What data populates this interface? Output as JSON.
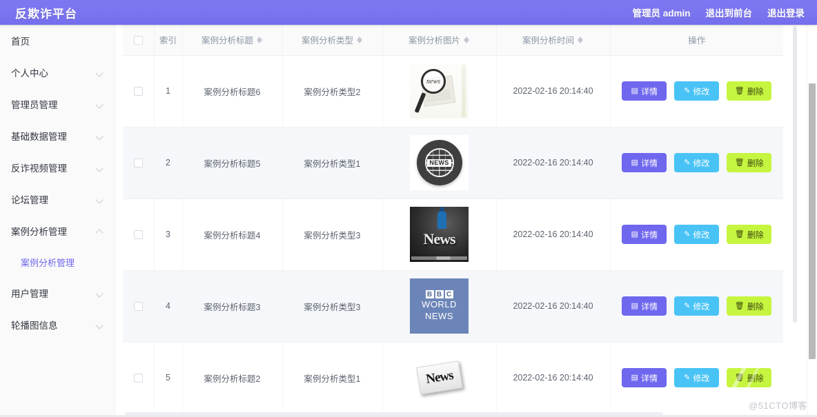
{
  "header": {
    "brand": "反欺诈平台",
    "user": "管理员 admin",
    "exit_front": "退出到前台",
    "logout": "退出登录"
  },
  "sidebar": {
    "items": [
      {
        "label": "首页",
        "expandable": false
      },
      {
        "label": "个人中心",
        "expandable": true
      },
      {
        "label": "管理员管理",
        "expandable": true
      },
      {
        "label": "基础数据管理",
        "expandable": true
      },
      {
        "label": "反诈视频管理",
        "expandable": true
      },
      {
        "label": "论坛管理",
        "expandable": true
      },
      {
        "label": "案例分析管理",
        "expandable": true,
        "expanded": true
      }
    ],
    "submenu": [
      {
        "label": "案例分析管理",
        "active": true
      }
    ],
    "items_after": [
      {
        "label": "用户管理",
        "expandable": true
      },
      {
        "label": "轮播图信息",
        "expandable": true
      }
    ]
  },
  "table": {
    "columns": [
      {
        "key": "check",
        "label": "",
        "sortable": false
      },
      {
        "key": "index",
        "label": "索引",
        "sortable": false
      },
      {
        "key": "title",
        "label": "案例分析标题",
        "sortable": true
      },
      {
        "key": "type",
        "label": "案例分析类型",
        "sortable": true
      },
      {
        "key": "image",
        "label": "案例分析图片",
        "sortable": true
      },
      {
        "key": "time",
        "label": "案例分析时间",
        "sortable": true
      },
      {
        "key": "ops",
        "label": "操作",
        "sortable": false
      }
    ],
    "rows": [
      {
        "index": "1",
        "title": "案例分析标题6",
        "type": "案例分析类型2",
        "image": "news-magnifier-thumb",
        "time": "2022-02-16 20:14:40"
      },
      {
        "index": "2",
        "title": "案例分析标题5",
        "type": "案例分析类型1",
        "image": "news-globe-thumb",
        "time": "2022-02-16 20:14:40"
      },
      {
        "index": "3",
        "title": "案例分析标题4",
        "type": "案例分析类型3",
        "image": "news-dark-thumb",
        "time": "2022-02-16 20:14:40"
      },
      {
        "index": "4",
        "title": "案例分析标题3",
        "type": "案例分析类型3",
        "image": "bbc-world-news-thumb",
        "time": "2022-02-16 20:14:40"
      },
      {
        "index": "5",
        "title": "案例分析标题2",
        "type": "案例分析类型1",
        "image": "news-paper-thumb",
        "time": "2022-02-16 20:14:40"
      }
    ],
    "buttons": {
      "detail": "详情",
      "edit": "修改",
      "delete": "删除"
    }
  },
  "thumbs": {
    "t1_word": "news",
    "t2_word": "NEWS",
    "t3_word": "News",
    "t4_bbc": [
      "B",
      "B",
      "C"
    ],
    "t4_line1": "WORLD",
    "t4_line2": "NEWS",
    "t5_word": "News"
  },
  "colors": {
    "brand_purple": "#7a74ef",
    "btn_detail": "#6f67ee",
    "btn_edit": "#49c3f5",
    "btn_delete": "#c6f53f",
    "submenu_active": "#6f68ee",
    "row_stripe": "#f5f7fa"
  },
  "watermark": "@51CTO博客"
}
